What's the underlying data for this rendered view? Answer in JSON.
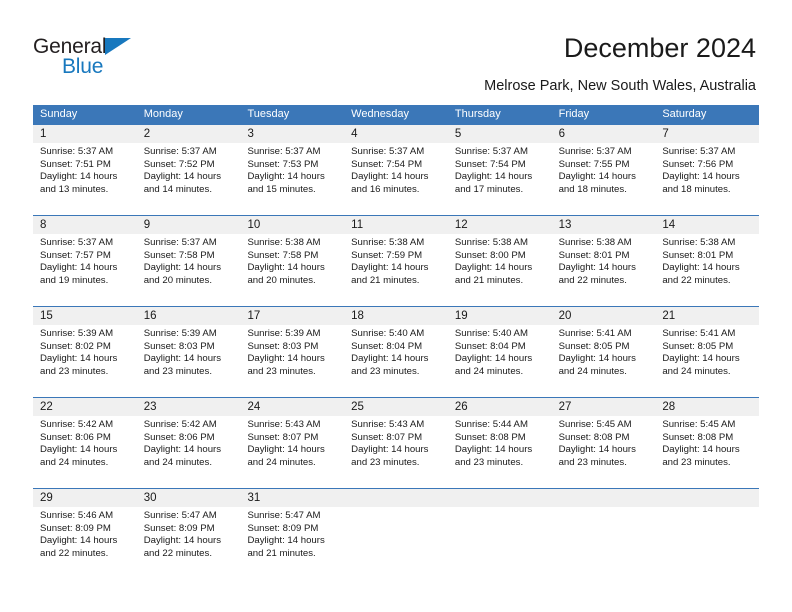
{
  "brand": {
    "name_part1": "General",
    "name_part2": "Blue",
    "logo_icon": "blue-triangle-icon"
  },
  "header": {
    "title": "December 2024",
    "subtitle": "Melrose Park, New South Wales, Australia"
  },
  "colors": {
    "header_blue": "#3b77b8",
    "brand_blue": "#1878be",
    "day_number_bg": "#f0f0f0",
    "text": "#1a1a1a"
  },
  "calendar": {
    "day_headers": [
      "Sunday",
      "Monday",
      "Tuesday",
      "Wednesday",
      "Thursday",
      "Friday",
      "Saturday"
    ],
    "weeks": [
      [
        {
          "day": "1",
          "sunrise": "Sunrise: 5:37 AM",
          "sunset": "Sunset: 7:51 PM",
          "daylight": "Daylight: 14 hours and 13 minutes."
        },
        {
          "day": "2",
          "sunrise": "Sunrise: 5:37 AM",
          "sunset": "Sunset: 7:52 PM",
          "daylight": "Daylight: 14 hours and 14 minutes."
        },
        {
          "day": "3",
          "sunrise": "Sunrise: 5:37 AM",
          "sunset": "Sunset: 7:53 PM",
          "daylight": "Daylight: 14 hours and 15 minutes."
        },
        {
          "day": "4",
          "sunrise": "Sunrise: 5:37 AM",
          "sunset": "Sunset: 7:54 PM",
          "daylight": "Daylight: 14 hours and 16 minutes."
        },
        {
          "day": "5",
          "sunrise": "Sunrise: 5:37 AM",
          "sunset": "Sunset: 7:54 PM",
          "daylight": "Daylight: 14 hours and 17 minutes."
        },
        {
          "day": "6",
          "sunrise": "Sunrise: 5:37 AM",
          "sunset": "Sunset: 7:55 PM",
          "daylight": "Daylight: 14 hours and 18 minutes."
        },
        {
          "day": "7",
          "sunrise": "Sunrise: 5:37 AM",
          "sunset": "Sunset: 7:56 PM",
          "daylight": "Daylight: 14 hours and 18 minutes."
        }
      ],
      [
        {
          "day": "8",
          "sunrise": "Sunrise: 5:37 AM",
          "sunset": "Sunset: 7:57 PM",
          "daylight": "Daylight: 14 hours and 19 minutes."
        },
        {
          "day": "9",
          "sunrise": "Sunrise: 5:37 AM",
          "sunset": "Sunset: 7:58 PM",
          "daylight": "Daylight: 14 hours and 20 minutes."
        },
        {
          "day": "10",
          "sunrise": "Sunrise: 5:38 AM",
          "sunset": "Sunset: 7:58 PM",
          "daylight": "Daylight: 14 hours and 20 minutes."
        },
        {
          "day": "11",
          "sunrise": "Sunrise: 5:38 AM",
          "sunset": "Sunset: 7:59 PM",
          "daylight": "Daylight: 14 hours and 21 minutes."
        },
        {
          "day": "12",
          "sunrise": "Sunrise: 5:38 AM",
          "sunset": "Sunset: 8:00 PM",
          "daylight": "Daylight: 14 hours and 21 minutes."
        },
        {
          "day": "13",
          "sunrise": "Sunrise: 5:38 AM",
          "sunset": "Sunset: 8:01 PM",
          "daylight": "Daylight: 14 hours and 22 minutes."
        },
        {
          "day": "14",
          "sunrise": "Sunrise: 5:38 AM",
          "sunset": "Sunset: 8:01 PM",
          "daylight": "Daylight: 14 hours and 22 minutes."
        }
      ],
      [
        {
          "day": "15",
          "sunrise": "Sunrise: 5:39 AM",
          "sunset": "Sunset: 8:02 PM",
          "daylight": "Daylight: 14 hours and 23 minutes."
        },
        {
          "day": "16",
          "sunrise": "Sunrise: 5:39 AM",
          "sunset": "Sunset: 8:03 PM",
          "daylight": "Daylight: 14 hours and 23 minutes."
        },
        {
          "day": "17",
          "sunrise": "Sunrise: 5:39 AM",
          "sunset": "Sunset: 8:03 PM",
          "daylight": "Daylight: 14 hours and 23 minutes."
        },
        {
          "day": "18",
          "sunrise": "Sunrise: 5:40 AM",
          "sunset": "Sunset: 8:04 PM",
          "daylight": "Daylight: 14 hours and 23 minutes."
        },
        {
          "day": "19",
          "sunrise": "Sunrise: 5:40 AM",
          "sunset": "Sunset: 8:04 PM",
          "daylight": "Daylight: 14 hours and 24 minutes."
        },
        {
          "day": "20",
          "sunrise": "Sunrise: 5:41 AM",
          "sunset": "Sunset: 8:05 PM",
          "daylight": "Daylight: 14 hours and 24 minutes."
        },
        {
          "day": "21",
          "sunrise": "Sunrise: 5:41 AM",
          "sunset": "Sunset: 8:05 PM",
          "daylight": "Daylight: 14 hours and 24 minutes."
        }
      ],
      [
        {
          "day": "22",
          "sunrise": "Sunrise: 5:42 AM",
          "sunset": "Sunset: 8:06 PM",
          "daylight": "Daylight: 14 hours and 24 minutes."
        },
        {
          "day": "23",
          "sunrise": "Sunrise: 5:42 AM",
          "sunset": "Sunset: 8:06 PM",
          "daylight": "Daylight: 14 hours and 24 minutes."
        },
        {
          "day": "24",
          "sunrise": "Sunrise: 5:43 AM",
          "sunset": "Sunset: 8:07 PM",
          "daylight": "Daylight: 14 hours and 24 minutes."
        },
        {
          "day": "25",
          "sunrise": "Sunrise: 5:43 AM",
          "sunset": "Sunset: 8:07 PM",
          "daylight": "Daylight: 14 hours and 23 minutes."
        },
        {
          "day": "26",
          "sunrise": "Sunrise: 5:44 AM",
          "sunset": "Sunset: 8:08 PM",
          "daylight": "Daylight: 14 hours and 23 minutes."
        },
        {
          "day": "27",
          "sunrise": "Sunrise: 5:45 AM",
          "sunset": "Sunset: 8:08 PM",
          "daylight": "Daylight: 14 hours and 23 minutes."
        },
        {
          "day": "28",
          "sunrise": "Sunrise: 5:45 AM",
          "sunset": "Sunset: 8:08 PM",
          "daylight": "Daylight: 14 hours and 23 minutes."
        }
      ],
      [
        {
          "day": "29",
          "sunrise": "Sunrise: 5:46 AM",
          "sunset": "Sunset: 8:09 PM",
          "daylight": "Daylight: 14 hours and 22 minutes."
        },
        {
          "day": "30",
          "sunrise": "Sunrise: 5:47 AM",
          "sunset": "Sunset: 8:09 PM",
          "daylight": "Daylight: 14 hours and 22 minutes."
        },
        {
          "day": "31",
          "sunrise": "Sunrise: 5:47 AM",
          "sunset": "Sunset: 8:09 PM",
          "daylight": "Daylight: 14 hours and 21 minutes."
        },
        {
          "day": "",
          "sunrise": "",
          "sunset": "",
          "daylight": ""
        },
        {
          "day": "",
          "sunrise": "",
          "sunset": "",
          "daylight": ""
        },
        {
          "day": "",
          "sunrise": "",
          "sunset": "",
          "daylight": ""
        },
        {
          "day": "",
          "sunrise": "",
          "sunset": "",
          "daylight": ""
        }
      ]
    ]
  }
}
